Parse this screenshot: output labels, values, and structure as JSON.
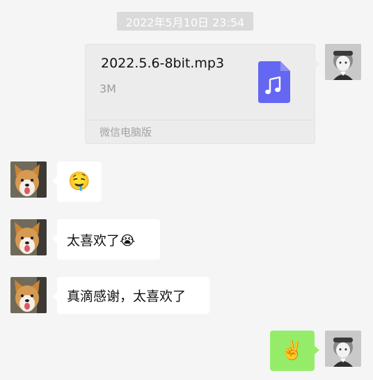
{
  "timestamp": "2022年5月10日 23:54",
  "file_message": {
    "file_name": "2022.5.6-8bit.mp3",
    "file_size": "3M",
    "source": "微信电脑版",
    "icon": "music-file-icon",
    "icon_color": "#6467f2"
  },
  "messages": [
    {
      "side": "left",
      "text": "🤤",
      "note": "heart-eyes drooling emoji"
    },
    {
      "side": "left",
      "text": "太喜欢了😭"
    },
    {
      "side": "left",
      "text": "真滴感谢，太喜欢了"
    },
    {
      "side": "right",
      "text": "✌️"
    }
  ],
  "colors": {
    "background": "#f5f5f5",
    "bubble_white": "#ffffff",
    "bubble_green": "#95ec69",
    "timestamp_bg": "#dadada"
  }
}
